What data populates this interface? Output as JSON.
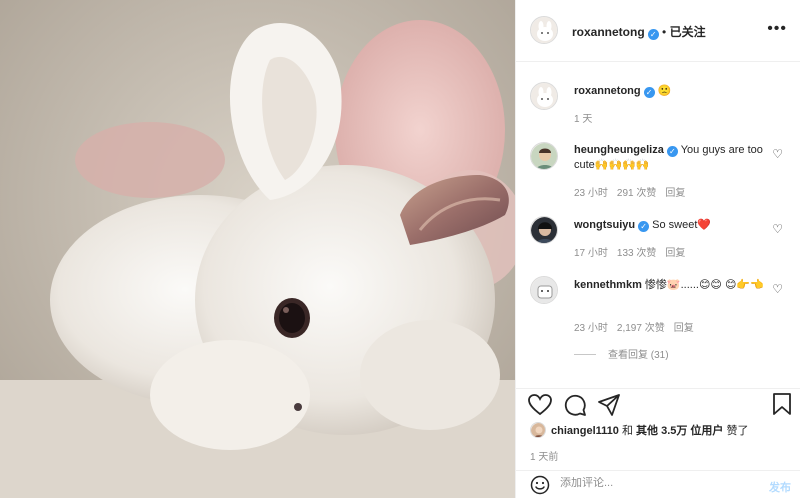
{
  "post": {
    "author": "roxannetong",
    "follow_sep": "•",
    "follow_status": "已关注",
    "caption_emoji": "🙁",
    "caption_time": "1 天",
    "likes_user": "chiangel1110",
    "likes_text_mid": "和",
    "likes_others": "其他 3.5万 位用户",
    "likes_text_end": "赞了",
    "post_time": "1 天前",
    "comment_placeholder": "添加评论...",
    "post_button": "发布",
    "view_replies": "查看回复 (31)",
    "more_icon": "•••"
  },
  "comments": [
    {
      "user": "heungheungeliza",
      "text": "You guys are too cute🙌🙌🙌🙌",
      "time": "23 小时",
      "likes": "291 次赞",
      "reply": "回复"
    },
    {
      "user": "wongtsuiyu",
      "text": "So sweet❤️",
      "time": "17 小时",
      "likes": "133 次赞",
      "reply": "回复"
    },
    {
      "user": "kennethmkm",
      "text": "惨惨🐷......😊😊 😊👉👈",
      "time": "23 小时",
      "likes": "2,197 次赞",
      "reply": "回复"
    }
  ],
  "icons": {
    "heart": "heart-icon",
    "comment": "comment-icon",
    "share": "share-icon",
    "bookmark": "bookmark-icon",
    "smiley": "smiley-icon"
  },
  "colors": {
    "link": "#3897f0",
    "muted": "#8e8e8e",
    "text": "#262626",
    "post_button": "#b3dbff"
  }
}
